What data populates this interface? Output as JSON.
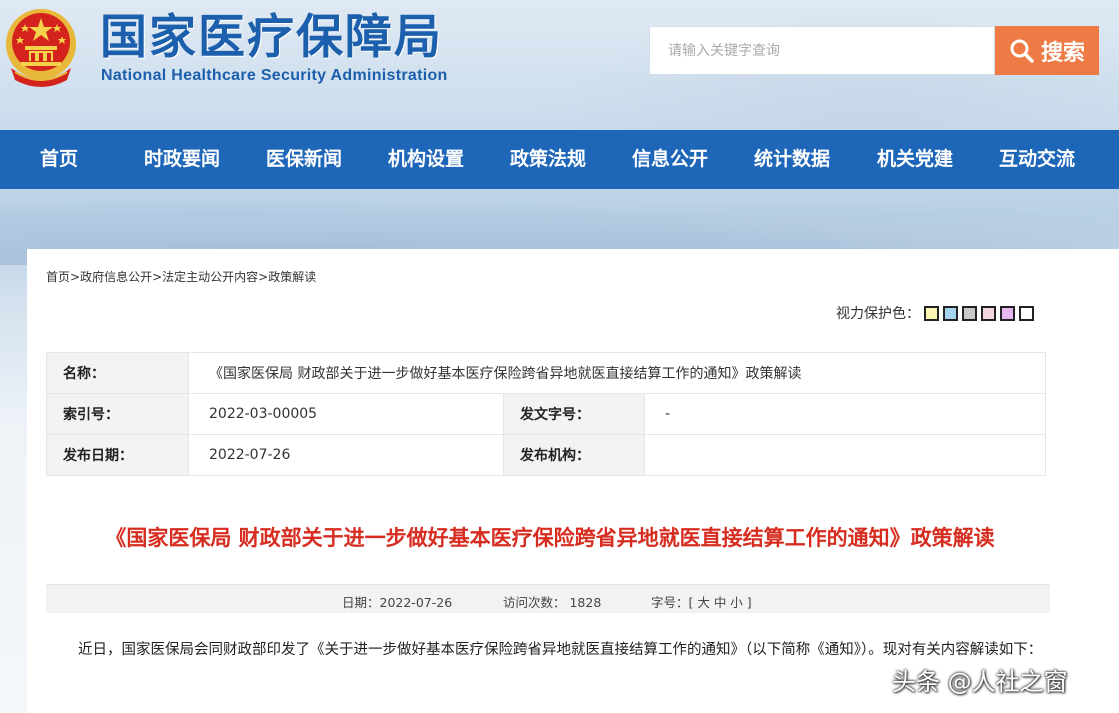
{
  "header": {
    "title": "国家医疗保障局",
    "subtitle": "National Healthcare Security Administration",
    "emblem_icon": "national-emblem-icon"
  },
  "search": {
    "placeholder": "请输入关键字查询",
    "button_label": "搜索",
    "button_color": "#ee7a45"
  },
  "nav": {
    "color": "#1e66b8",
    "items": [
      "首页",
      "时政要闻",
      "医保新闻",
      "机构设置",
      "政策法规",
      "信息公开",
      "统计数据",
      "机关党建",
      "互动交流"
    ]
  },
  "breadcrumb": {
    "items": [
      "首页",
      "政府信息公开",
      "法定主动公开内容",
      "政策解读"
    ],
    "separator": ">"
  },
  "eye_protection": {
    "label": "视力保护色：",
    "swatches": [
      "#fdf6b3",
      "#a7d4f0",
      "#c9c9c9",
      "#f3d6df",
      "#e6b6f2",
      "#ffffff"
    ]
  },
  "meta": {
    "name_label": "名称：",
    "name_value": "《国家医保局 财政部关于进一步做好基本医疗保险跨省异地就医直接结算工作的通知》政策解读",
    "index_label": "索引号：",
    "index_value": "2022-03-00005",
    "doc_no_label": "发文字号：",
    "doc_no_value": "-",
    "date_label": "发布日期：",
    "date_value": "2022-07-26",
    "org_label": "发布机构：",
    "org_value": ""
  },
  "article": {
    "title": "《国家医保局 财政部关于进一步做好基本医疗保险跨省异地就医直接结算工作的通知》政策解读",
    "title_color": "#d62d20",
    "date_text": "日期：2022-07-26",
    "visits_text": "访问次数： 1828",
    "font_size_text": "字号：[ 大 中 小 ]",
    "body": "近日，国家医保局会同财政部印发了《关于进一步做好基本医疗保险跨省异地就医直接结算工作的通知》（以下简称《通知》）。现对有关内容解读如下："
  },
  "watermark": "头条 @人社之窗"
}
